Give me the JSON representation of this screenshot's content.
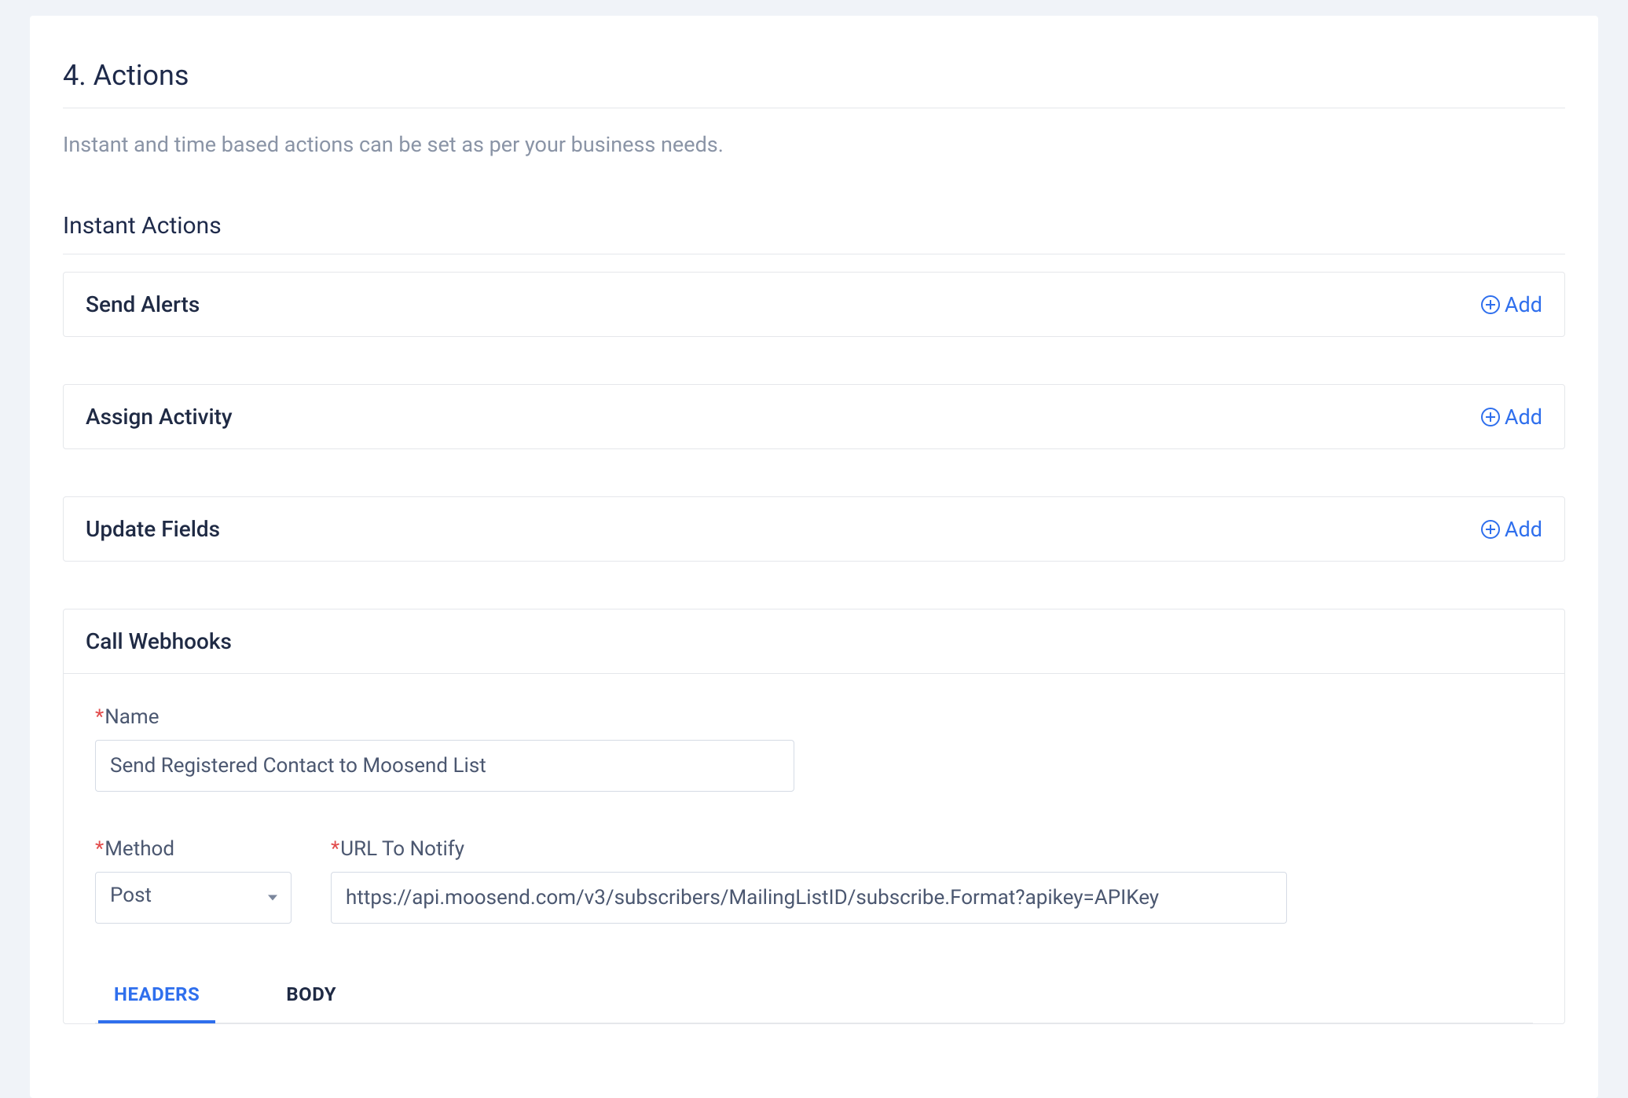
{
  "section": {
    "title": "4. Actions",
    "description": "Instant and time based actions can be set as per your business needs."
  },
  "instant": {
    "title": "Instant Actions",
    "addLabel": "Add",
    "rows": {
      "sendAlerts": "Send Alerts",
      "assignActivity": "Assign Activity",
      "updateFields": "Update Fields"
    }
  },
  "webhook": {
    "title": "Call Webhooks",
    "nameLabel": "Name",
    "nameValue": "Send Registered Contact to Moosend List",
    "methodLabel": "Method",
    "methodValue": "Post",
    "urlLabel": "URL To Notify",
    "urlValue": "https://api.moosend.com/v3/subscribers/MailingListID/subscribe.Format?apikey=APIKey",
    "tabs": {
      "headers": "HEADERS",
      "body": "BODY"
    }
  }
}
